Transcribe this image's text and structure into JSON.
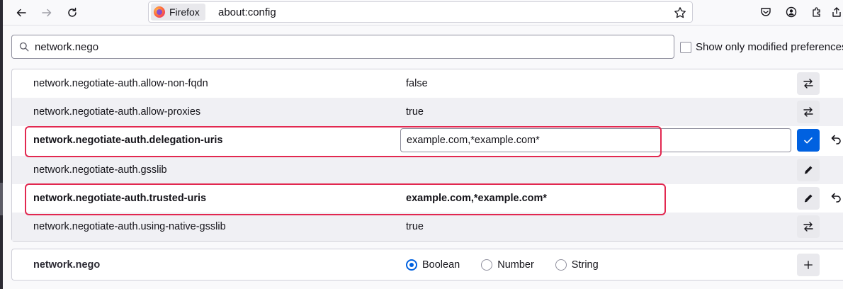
{
  "browser": {
    "identity_label": "Firefox",
    "url": "about:config"
  },
  "icons": {
    "back": "arrow-left-icon",
    "forward": "arrow-right-icon",
    "reload": "reload-icon",
    "bookmark": "star-icon",
    "pocket": "pocket-icon",
    "account": "account-icon",
    "extensions": "puzzle-icon",
    "share": "share-icon",
    "search": "search-icon",
    "toggle": "toggle-arrows-icon",
    "edit": "pencil-icon",
    "save": "check-icon",
    "reset": "undo-icon",
    "add": "plus-icon"
  },
  "search": {
    "value": "network.nego",
    "show_modified_label": "Show only modified preferences"
  },
  "preferences": [
    {
      "name": "network.negotiate-auth.allow-non-fqdn",
      "value": "false",
      "modified": false,
      "action": "toggle"
    },
    {
      "name": "network.negotiate-auth.allow-proxies",
      "value": "true",
      "modified": false,
      "action": "toggle"
    },
    {
      "name": "network.negotiate-auth.delegation-uris",
      "value": "example.com,*example.com*",
      "modified": true,
      "action": "save",
      "editing": true
    },
    {
      "name": "network.negotiate-auth.gsslib",
      "value": "",
      "modified": false,
      "action": "edit"
    },
    {
      "name": "network.negotiate-auth.trusted-uris",
      "value": "example.com,*example.com*",
      "modified": true,
      "action": "edit"
    },
    {
      "name": "network.negotiate-auth.using-native-gsslib",
      "value": "true",
      "modified": false,
      "action": "toggle"
    }
  ],
  "add_pref": {
    "name": "network.nego",
    "types": [
      "Boolean",
      "Number",
      "String"
    ],
    "selected": "Boolean"
  },
  "colors": {
    "accent": "#0061e0",
    "highlight": "#e22850"
  }
}
